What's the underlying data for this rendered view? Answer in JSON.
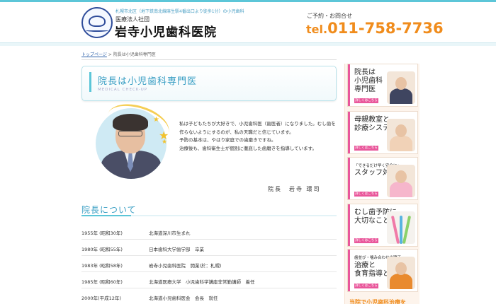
{
  "header": {
    "address": "札幌市北区（地下鉄南北線麻生駅4番出口より徒歩1分）の小児歯科",
    "corporation": "医療法人社団",
    "clinic_name": "岩寺小児歯科医院",
    "contact_label": "ご予約・お問合せ",
    "tel_prefix": "tel.",
    "tel_number": "011-758-7736"
  },
  "breadcrumb": {
    "home": "トップページ",
    "separator": " > ",
    "current": "院長は小児歯科専門医"
  },
  "page_title": {
    "title": "院長は小児歯科専門医",
    "subtitle": "MEDICAL CHECK-UP"
  },
  "message": {
    "paragraph1": "私は子どもたちが大好きで、小児歯科医（歯医者）になりました。むし歯を作らないようにするのが、私の天職だと信じています。",
    "paragraph2": "予防の基本は、やはり家庭での歯磨きですね。",
    "paragraph3": "治療後も、歯科衛生士が個別に徹底した歯磨きを指導しています。",
    "signature": "院長　岩寺 環司"
  },
  "about": {
    "title": "院長について",
    "history": [
      {
        "year": "1955年 (昭和30年)",
        "event": "北海道深川市生まれ"
      },
      {
        "year": "1980年 (昭和55年)",
        "event": "日本歯科大学歯学部　卒業"
      },
      {
        "year": "1983年 (昭和58年)",
        "event": "岩寺小児歯科医院　開業(於：札幌)"
      },
      {
        "year": "1985年 (昭和60年)",
        "event": "北海道医療大学　小児歯科学講座非常勤講師　着任"
      },
      {
        "year": "2000年(平成12年)",
        "event": "北海道小児歯科医会　会長　就任"
      }
    ]
  },
  "sidebar": {
    "more_label": "詳しくはこちら",
    "cards": [
      {
        "title_l1": "院長は",
        "title_l2": "小児歯科",
        "title_l3": "専門医"
      },
      {
        "title_l1": "母親教室と",
        "title_l2": "診療システム",
        "title_l3": ""
      },
      {
        "title_l1": "「できるだけ早く安全に」",
        "title_l2": "スタッフ対応",
        "title_l3": ""
      },
      {
        "title_l1": "むし歯予防に",
        "title_l2": "大切なこと",
        "title_l3": ""
      },
      {
        "title_l1": "歯並び・噛み合わせの矯正",
        "title_l2": "治療と",
        "title_l3": "食育指導とは"
      }
    ],
    "bottom_text": "当院で小児歯科治療を"
  },
  "colors": {
    "accent": "#5cc6d8",
    "title": "#3a9fc4",
    "tel": "#f08c1c",
    "sidebar_pink": "#e9579b"
  }
}
